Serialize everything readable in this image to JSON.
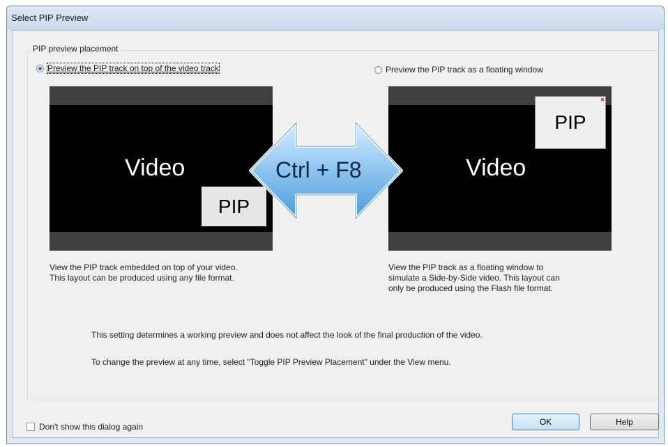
{
  "dialog": {
    "title": "Select PIP Preview",
    "group_label": "PIP preview placement",
    "options": [
      {
        "label": "Preview the PIP track on top of the video track",
        "selected": true
      },
      {
        "label": "Preview the PIP track as a floating window",
        "selected": false
      }
    ],
    "left_preview": {
      "video_label": "Video",
      "pip_label": "PIP",
      "description": [
        "View the PIP track embedded on top of your video.",
        "This layout can be produced using any file format."
      ]
    },
    "right_preview": {
      "video_label": "Video",
      "pip_label": "PIP",
      "description": [
        "View the PIP track as a floating window to",
        "simulate a Side-by-Side video. This layout can",
        "only be produced using the Flash file format."
      ]
    },
    "shortcut_label": "Ctrl + F8",
    "info_lines": [
      "This setting determines a working preview and does not affect the look of the final production of the video.",
      "To change the preview at any time, select \"Toggle PIP Preview Placement\" under the View menu."
    ],
    "dont_show_label": "Don't show this dialog again",
    "dont_show_checked": false,
    "ok_label": "OK",
    "help_label": "Help"
  },
  "colors": {
    "accent": "#2b6bd6",
    "arrow_fill": "#8cc4ef",
    "pip_close": "#e2533a"
  }
}
